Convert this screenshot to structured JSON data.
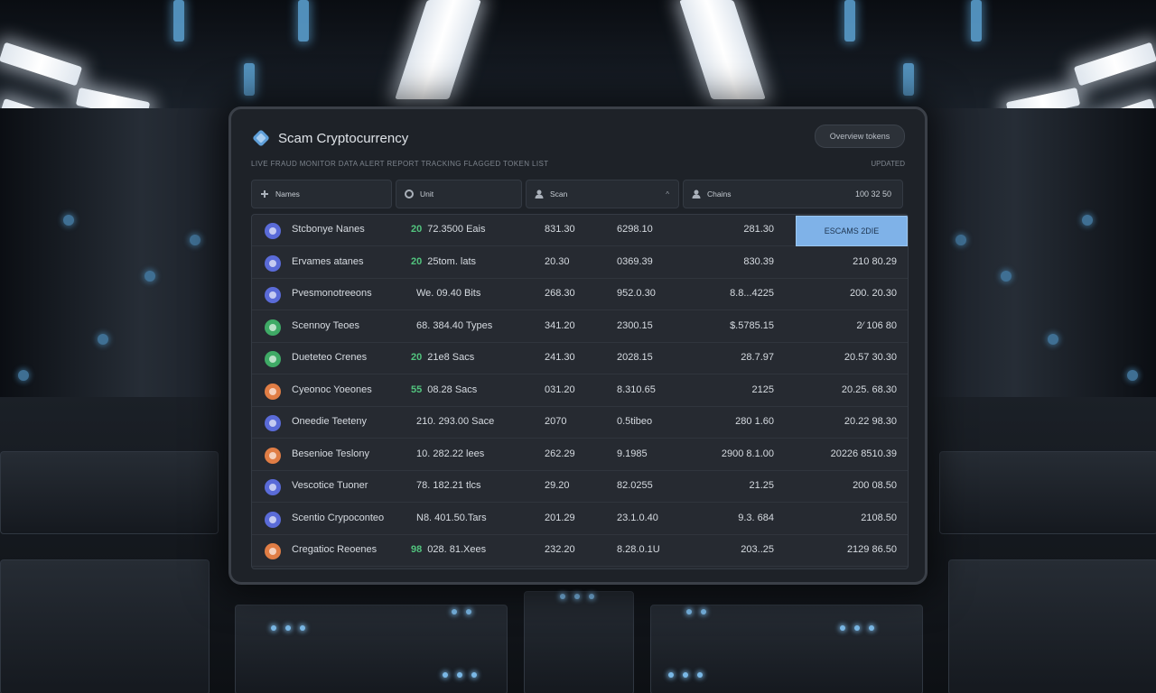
{
  "app": {
    "title": "Scam Cryptocurrency",
    "top_button": "Overview tokens",
    "subtitle": "LIVE FRAUD MONITOR DATA ALERT REPORT TRACKING FLAGGED TOKEN LIST",
    "subtitle_right": "UPDATED"
  },
  "header": {
    "col_name": "Names",
    "col_unit": "Unit",
    "col_scan": "Scan",
    "col_scan_sort": "^",
    "col_chains": "Chains",
    "col_chains_right": "100 32 50"
  },
  "colors": {
    "accent": "#7fb2e8",
    "positive": "#52c47e",
    "icon_blue": "#5a6bd8",
    "icon_green": "#3faa66",
    "icon_orange": "#e07d45"
  },
  "rows": [
    {
      "icon": "coin-icon",
      "color": "#5a6bd8",
      "name": "Stcbonye Nanes",
      "vol_num": "20",
      "vol_text": "72.3500 Eais",
      "a": "831.30",
      "b": "6298.10",
      "c": "281.30",
      "d": "",
      "action": "ESCAMS 2DIE"
    },
    {
      "icon": "coin-icon",
      "color": "#5a6bd8",
      "name": "Ervames atanes",
      "vol_num": "20",
      "vol_text": "25tom. lats",
      "a": "20.30",
      "b": "0369.39",
      "c": "830.39",
      "d": "210 80.29",
      "action": ""
    },
    {
      "icon": "coin-icon",
      "color": "#5a6bd8",
      "name": "Pvesmonotreeons",
      "vol_num": "",
      "vol_text": "We. 09.40 Bits",
      "a": "268.30",
      "b": "952.0.30",
      "c": "8.8...4225",
      "d": "200. 20.30",
      "action": ""
    },
    {
      "icon": "coin-icon",
      "color": "#3faa66",
      "name": "Scennoy Teoes",
      "vol_num": "",
      "vol_text": "68. 384.40 Types",
      "a": "341.20",
      "b": "2300.15",
      "c": "$.5785.15",
      "d": "2⁄ 106 80",
      "action": ""
    },
    {
      "icon": "coin-icon",
      "color": "#3faa66",
      "name": "Dueteteo Crenes",
      "vol_num": "20",
      "vol_text": "21e8 Sacs",
      "a": "241.30",
      "b": "2028.15",
      "c": "28.7.97",
      "d": "20.57 30.30",
      "action": ""
    },
    {
      "icon": "coin-icon",
      "color": "#e07d45",
      "name": "Cyeonoc Yoeones",
      "vol_num": "55",
      "vol_text": "08.28 Sacs",
      "a": "031.20",
      "b": "8.310.65",
      "c": "2125",
      "d": "20.25. 68.30",
      "action": ""
    },
    {
      "icon": "coin-icon",
      "color": "#5a6bd8",
      "name": "Oneedie Teeteny",
      "vol_num": "",
      "vol_text": "210. 293.00 Sace",
      "a": "2070",
      "b": "0.5tibeo",
      "c": "280 1.60",
      "d": "20.22 98.30",
      "action": ""
    },
    {
      "icon": "coin-icon",
      "color": "#e07d45",
      "name": "Besenioe Teslony",
      "vol_num": "",
      "vol_text": "10. 282.22 lees",
      "a": "262.29",
      "b": "9.1985",
      "c": "2900 8.1.00",
      "d": "20226 8510.39",
      "action": ""
    },
    {
      "icon": "coin-icon",
      "color": "#5a6bd8",
      "name": "Vescotice Tuoner",
      "vol_num": "",
      "vol_text": "78. 182.21 tlcs",
      "a": "29.20",
      "b": "82.0255",
      "c": "21.25",
      "d": "200 08.50",
      "action": ""
    },
    {
      "icon": "coin-icon",
      "color": "#5a6bd8",
      "name": "Scentio Crypoconteo",
      "vol_num": "",
      "vol_text": "N8. 401.50.Tars",
      "a": "201.29",
      "b": "23.1.0.40",
      "c": "9.3. 684",
      "d": "2108.50",
      "action": ""
    },
    {
      "icon": "coin-icon",
      "color": "#e07d45",
      "name": "Cregatioc Reoenes",
      "vol_num": "98",
      "vol_text": "028. 81.Xees",
      "a": "232.20",
      "b": "8.28.0.1U",
      "c": "203..25",
      "d": "2129 86.50",
      "action": ""
    }
  ]
}
